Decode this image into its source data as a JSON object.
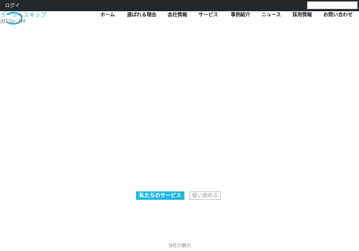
{
  "admin_bar": {
    "login_label": "ログイ",
    "search_value": ""
  },
  "logo": {
    "name_jp": "ラーッヘスキップ",
    "name_en": "JQT   Co., Ltd"
  },
  "nav": {
    "items": [
      {
        "label": "ホーム"
      },
      {
        "label": "選ばれる理由"
      },
      {
        "label": "会社情報"
      },
      {
        "label": "サービス"
      },
      {
        "label": "事例紹介"
      },
      {
        "label": "ニュース"
      },
      {
        "label": "採用情報"
      },
      {
        "label": "お問い合わせ"
      }
    ]
  },
  "hero": {
    "primary_button": "私たちのサービス",
    "secondary_button": "使い始める"
  },
  "section": {
    "label": "当社の魅力"
  },
  "colors": {
    "accent": "#20b8e0",
    "admin_bar": "#23282d",
    "logo": "#2aa7dc"
  }
}
